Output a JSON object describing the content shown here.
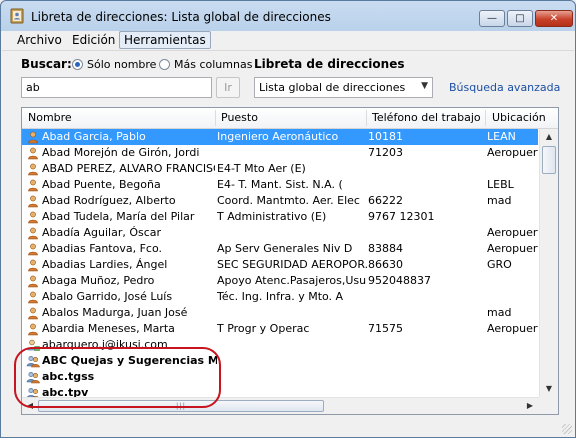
{
  "window": {
    "title": "Libreta de direcciones: Lista global de direcciones",
    "minimize": "—",
    "maximize": "□",
    "close": "✕"
  },
  "menu": [
    "Archivo",
    "Edición",
    "Herramientas"
  ],
  "search": {
    "label": "Buscar:",
    "option_name": "Sólo nombre",
    "option_more": "Más columnas",
    "query": "ab",
    "go_label": "Ir",
    "book_label": "Libreta de direcciones",
    "book_selected": "Lista global de direcciones",
    "advanced_link": "Búsqueda avanzada"
  },
  "columns": [
    "Nombre",
    "Puesto",
    "Teléfono del trabajo",
    "Ubicación"
  ],
  "rows": [
    {
      "icon": "person",
      "name": "Abad Garcia, Pablo",
      "puesto": "Ingeniero Aeronáutico",
      "phone": "10181",
      "loc": "LEAN",
      "selected": true
    },
    {
      "icon": "person",
      "name": "Abad Morejón de Girón, Jordi",
      "puesto": "",
      "phone": "71203",
      "loc": "Aeropuerto"
    },
    {
      "icon": "person",
      "name": "ABAD PEREZ, ALVARO FRANCISCO",
      "puesto": "E4-T Mto Aer (E)",
      "phone": "",
      "loc": ""
    },
    {
      "icon": "person",
      "name": "Abad Puente, Begoña",
      "puesto": "E4- T. Mant. Sist. N.A. (",
      "phone": "",
      "loc": "LEBL"
    },
    {
      "icon": "person",
      "name": "Abad Rodríguez, Alberto",
      "puesto": "Coord. Mantmto. Aer. Elec",
      "phone": "66222",
      "loc": "mad"
    },
    {
      "icon": "person",
      "name": "Abad Tudela, María del Pilar",
      "puesto": "T Administrativo (E)",
      "phone": "9767 12301",
      "loc": ""
    },
    {
      "icon": "person",
      "name": "Abadía Aguilar, Óscar",
      "puesto": "",
      "phone": "",
      "loc": "Aeropuerto"
    },
    {
      "icon": "person",
      "name": "Abadias Fantova, Fco.",
      "puesto": "Ap Serv Generales Niv D",
      "phone": "83884",
      "loc": "Aeropuerto"
    },
    {
      "icon": "person",
      "name": "Abadias Lardies, Ángel",
      "puesto": "SEC SEGURIDAD AEROPOR...",
      "phone": "86630",
      "loc": "GRO"
    },
    {
      "icon": "person",
      "name": "Abaga Muñoz, Pedro",
      "puesto": "Apoyo Atenc.Pasajeros,Usu",
      "phone": "952048837",
      "loc": ""
    },
    {
      "icon": "person",
      "name": "Abalo Garrido, José Luís",
      "puesto": "Téc. Ing. Infra. y Mto. A",
      "phone": "",
      "loc": ""
    },
    {
      "icon": "person",
      "name": "Abalos Madurga, Juan José",
      "puesto": "",
      "phone": "",
      "loc": "mad"
    },
    {
      "icon": "person",
      "name": "Abardia Meneses, Marta",
      "puesto": "T Progr y Operac",
      "phone": "71575",
      "loc": "Aeropuerto"
    },
    {
      "icon": "contact",
      "name": "abarquero.j@ikusi.com",
      "puesto": "",
      "phone": "",
      "loc": ""
    },
    {
      "icon": "group",
      "name": "ABC Quejas y Sugerencias M...",
      "puesto": "",
      "phone": "",
      "loc": "",
      "group": true
    },
    {
      "icon": "group",
      "name": "abc.tgss",
      "puesto": "",
      "phone": "",
      "loc": "",
      "group": true
    },
    {
      "icon": "group",
      "name": "abc.tpv",
      "puesto": "",
      "phone": "",
      "loc": "",
      "group": true
    }
  ]
}
